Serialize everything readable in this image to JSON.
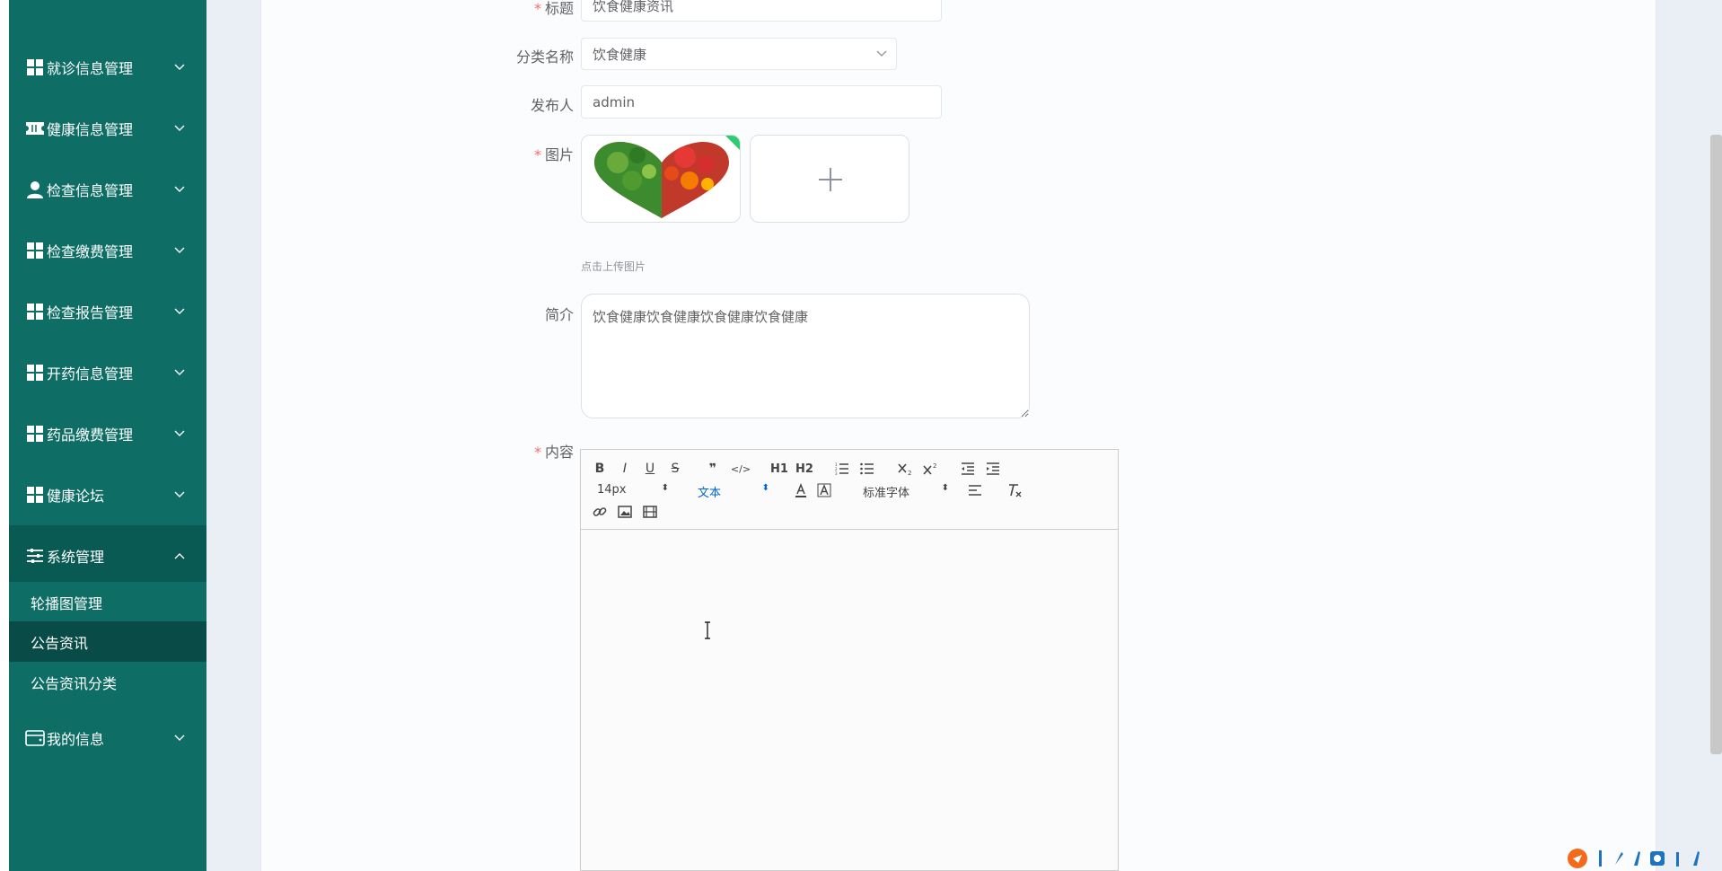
{
  "sidebar": {
    "menu": [
      {
        "label": "就诊信息管理",
        "icon": "grid-icon"
      },
      {
        "label": "健康信息管理",
        "icon": "ticket-icon"
      },
      {
        "label": "检查信息管理",
        "icon": "user-icon"
      },
      {
        "label": "检查缴费管理",
        "icon": "grid-icon"
      },
      {
        "label": "检查报告管理",
        "icon": "grid-icon"
      },
      {
        "label": "开药信息管理",
        "icon": "grid-icon"
      },
      {
        "label": "药品缴费管理",
        "icon": "grid-icon"
      },
      {
        "label": "健康论坛",
        "icon": "grid-icon"
      },
      {
        "label": "系统管理",
        "icon": "sliders-icon"
      }
    ],
    "submenu": [
      {
        "label": "轮播图管理"
      },
      {
        "label": "公告资讯"
      },
      {
        "label": "公告资讯分类"
      }
    ],
    "last_menu": {
      "label": "我的信息",
      "icon": "wallet-icon"
    }
  },
  "form": {
    "title": {
      "label": "标题",
      "value": "饮食健康资讯"
    },
    "category": {
      "label": "分类名称",
      "value": "饮食健康"
    },
    "publisher": {
      "label": "发布人",
      "value": "admin"
    },
    "image": {
      "label": "图片",
      "hint": "点击上传图片"
    },
    "intro": {
      "label": "简介",
      "value": "饮食健康饮食健康饮食健康饮食健康"
    },
    "content": {
      "label": "内容"
    }
  },
  "editor": {
    "font_size": "14px",
    "block_type": "文本",
    "font_family": "标准字体",
    "buttons": [
      "B",
      "I",
      "U",
      "S",
      "❞",
      "</>",
      "H1",
      "H2"
    ]
  },
  "colors": {
    "sidebar_bg": "#0e6e66",
    "sidebar_active": "#0a5a54",
    "sidebar_current": "#094b46",
    "required": "#f56c6c"
  }
}
